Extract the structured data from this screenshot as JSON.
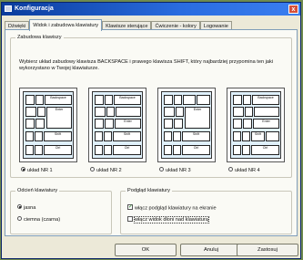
{
  "window": {
    "title": "Konfiguracja",
    "close_glyph": "x"
  },
  "tabs": [
    {
      "label": "Dźwięki"
    },
    {
      "label": "Widok i zabudowa klawiatury",
      "active": true
    },
    {
      "label": "Klawisze sterujące"
    },
    {
      "label": "Ćwiczenie - kolory"
    },
    {
      "label": "Logowanie"
    }
  ],
  "layout_group": {
    "title": "Zabudowa klawiszy",
    "description": "Wybierz układ zabudowy klawisza BACKSPACE i prawego klawisza SHIFT, który najbardziej przypomina ten jaki wykorzystano w Twojej klawiaturze.",
    "key_labels": {
      "backspace": "Backspace",
      "enter": "Enter",
      "shift": "Shift",
      "ctrl": "Ctrl"
    },
    "options": [
      {
        "label": "układ NR 1",
        "selected": true
      },
      {
        "label": "układ NR 2",
        "selected": false
      },
      {
        "label": "układ NR 3",
        "selected": false
      },
      {
        "label": "układ NR 4",
        "selected": false
      }
    ]
  },
  "shade_group": {
    "title": "Odcień klawiatury",
    "options": [
      {
        "label": "jasna",
        "selected": true
      },
      {
        "label": "ciemna (czarna)",
        "selected": false
      }
    ]
  },
  "preview_group": {
    "title": "Podgląd klawiatury",
    "options": [
      {
        "label": "włącz podgląd klawiatury na ekranie",
        "checked": true
      },
      {
        "label": "włącz widok dłoni nad klawiaturą",
        "checked": false
      }
    ]
  },
  "buttons": {
    "ok": "OK",
    "cancel": "Anuluj",
    "apply": "Zastosuj"
  }
}
